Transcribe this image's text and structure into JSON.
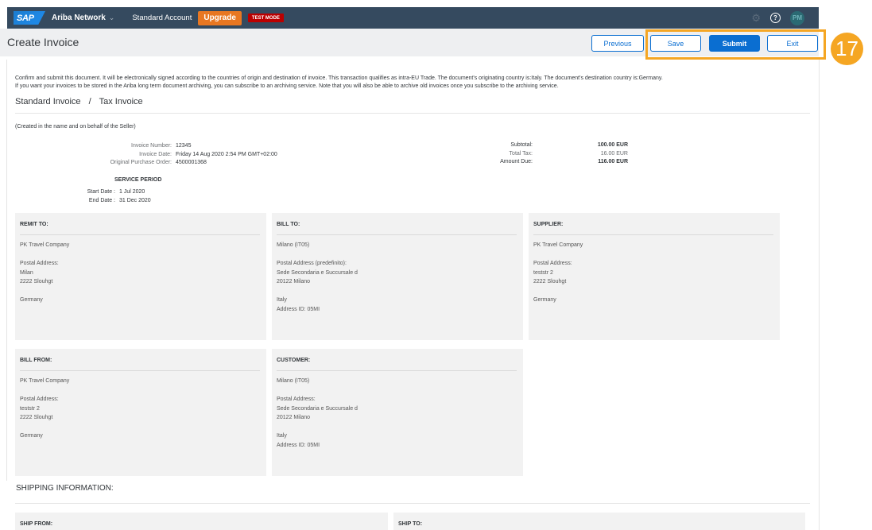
{
  "topbar": {
    "logo_text": "SAP",
    "app_name": "Ariba Network",
    "app_caret": "⌄",
    "account_label": "Standard Account",
    "upgrade_label": "Upgrade",
    "test_mode_label": "TEST MODE",
    "icons": {
      "settings": "⚙",
      "help": "?"
    },
    "user_initials": "PM",
    "colors": {
      "bar": "#354a5f",
      "upgrade": "#e87722",
      "test_mode": "#bb0000"
    }
  },
  "header": {
    "title": "Create Invoice",
    "buttons": {
      "previous": "Previous",
      "save": "Save",
      "submit": "Submit",
      "exit": "Exit"
    },
    "colors": {
      "primary": "#0a6ed1"
    }
  },
  "annotation": {
    "step_number": "17",
    "color": "#f5a623"
  },
  "notice": {
    "line1": "Confirm and submit this document. It will be electronically signed according to the countries of origin and destination of invoice. This transaction qualifies as intra-EU Trade. The document's originating country is:Italy. The document's destination country is:Germany.",
    "line2": "If you want your invoices to be stored in the Ariba long term document archiving, you can subscribe to an archiving service. Note that you will also be able to archive old invoices once you subscribe to the archiving service."
  },
  "document_type": {
    "primary": "Standard Invoice",
    "separator": "/",
    "secondary": "Tax Invoice"
  },
  "created_note": "(Created in the name and on behalf of the Seller)",
  "invoice_info": [
    {
      "label": "Invoice Number:",
      "value": "12345"
    },
    {
      "label": "Invoice Date:",
      "value": "Friday 14 Aug 2020 2:54 PM GMT+02:00"
    },
    {
      "label": "Original Purchase Order:",
      "value": "4500001368"
    }
  ],
  "service_period": {
    "title": "SERVICE PERIOD",
    "rows": [
      {
        "label": "Start Date :",
        "value": "1 Jul 2020"
      },
      {
        "label": "End Date :",
        "value": "31 Dec 2020"
      }
    ]
  },
  "totals": [
    {
      "label": "Subtotal:",
      "value": "100.00 EUR"
    },
    {
      "label": "Total Tax:",
      "value": "16.00 EUR"
    },
    {
      "label": "Amount Due:",
      "value": "116.00 EUR"
    }
  ],
  "cards": {
    "remit_to": {
      "title": "REMIT TO:",
      "name": "PK Travel Company",
      "address_label": "Postal Address:",
      "address_lines": [
        "Milan",
        "2222 Slouhgt"
      ],
      "country": "Germany"
    },
    "bill_to": {
      "title": "BILL TO:",
      "name": "Milano (IT05)",
      "address_label": "Postal Address (predefinito):",
      "address_lines": [
        "Sede Secondaria e Succursale d",
        "20122 Milano"
      ],
      "country": "Italy",
      "address_id": "Address ID: 05MI"
    },
    "supplier": {
      "title": "SUPPLIER:",
      "name": "PK Travel Company",
      "address_label": "Postal Address:",
      "address_lines": [
        "teststr 2",
        "2222 Slouhgt"
      ],
      "country": "Germany"
    },
    "bill_from": {
      "title": "BILL FROM:",
      "name": "PK Travel Company",
      "address_label": "Postal Address:",
      "address_lines": [
        "teststr 2",
        "2222 Slouhgt"
      ],
      "country": "Germany"
    },
    "customer": {
      "title": "CUSTOMER:",
      "name": "Milano (IT05)",
      "address_label": "Postal Address:",
      "address_lines": [
        "Sede Secondaria e Succursale d",
        "20122 Milano"
      ],
      "country": "Italy",
      "address_id": "Address ID: 05MI"
    }
  },
  "shipping": {
    "title": "SHIPPING INFORMATION:",
    "ship_from_title": "SHIP FROM:",
    "ship_to_title": "SHIP TO:"
  }
}
